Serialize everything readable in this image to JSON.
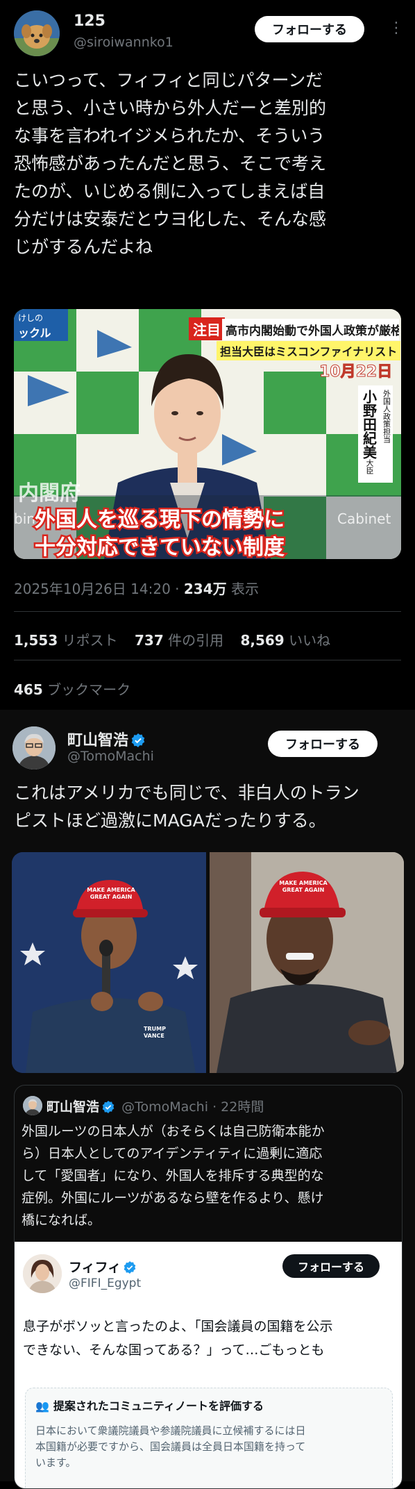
{
  "tweet1": {
    "display_name": "125",
    "handle": "@siroiwannko1",
    "follow_label": "フォローする",
    "more_icon": "more-icon",
    "text": "こいつって、フィフィと同じパターンだ\nと思う、小さい時から外人だーと差別的\nな事を言われイジメられたか、そういう\n恐怖感があったんだと思う、そこで考え\nたのが、いじめる側に入ってしまえば自\n分だけは安泰だとウヨ化した、そんな感\nじがするんだよね",
    "media": {
      "badge_top_left": "けしの",
      "badge_sub": "ックル",
      "tag_label": "注目",
      "headline": "高市内閣始動で外国人政策が厳格化?",
      "subheadline": "担当大臣はミスコンファイナリスト",
      "date_label": "10月22日",
      "side_role": "外国人政策担当",
      "side_name": "小野田紀美",
      "side_title": "大臣",
      "bg_left": "内閣府",
      "bg_left2": "binet",
      "bg_right": "Cabinet",
      "caption_line1": "外国人を巡る現下の情勢に",
      "caption_line2": "十分対応できていない制度"
    },
    "timestamp": "2025年10月26日 14:20",
    "views_count": "234万",
    "views_label": "表示",
    "reposts_count": "1,553",
    "reposts_label": "リポスト",
    "quotes_count": "737",
    "quotes_label": "件の引用",
    "likes_count": "8,569",
    "likes_label": "いいね",
    "bookmarks_count": "465",
    "bookmarks_label": "ブックマーク"
  },
  "tweet2": {
    "display_name": "町山智浩",
    "handle": "@TomoMachi",
    "follow_label": "フォローする",
    "text": "これはアメリカでも同じで、非白人のトラン\nピストほど過激にMAGAだったりする。",
    "media_left": {
      "hat_text": "MAKE AMERICA GREAT AGAIN",
      "shirt_text": "TRUMP VANCE"
    },
    "media_right": {
      "hat_text": "MAKE AMERICA GREAT AGAIN"
    },
    "quote": {
      "display_name": "町山智浩",
      "handle": "@TomoMachi",
      "time": "22時間",
      "text": "外国ルーツの日本人が（おそらくは自己防衛本能か\nら）日本人としてのアイデンティティに過剰に適応\nして「愛国者」になり、外国人を排斥する典型的な\n症例。外国にルーツがあるなら壁を作るより、懸け\n橋になれば。",
      "inner": {
        "display_name": "フィフィ",
        "handle": "@FIFI_Egypt",
        "follow_label": "フォローする",
        "text": "息子がボソッと言ったのよ、「国会議員の国籍を公示\nできない、そんな国ってある？」って…ごもっとも",
        "note_title": "提案されたコミュニティノートを評価する",
        "note_text": "日本において衆議院議員や参議院議員に立候補するには日\n本国籍が必要ですから、国会議員は全員日本国籍を持って\nいます。"
      }
    }
  },
  "colors": {
    "background": "#000000",
    "text": "#e7e9ea",
    "muted": "#71767b",
    "verified": "#1d9bf0",
    "caption_red": "#d9251d",
    "green": "#3fa34d"
  }
}
